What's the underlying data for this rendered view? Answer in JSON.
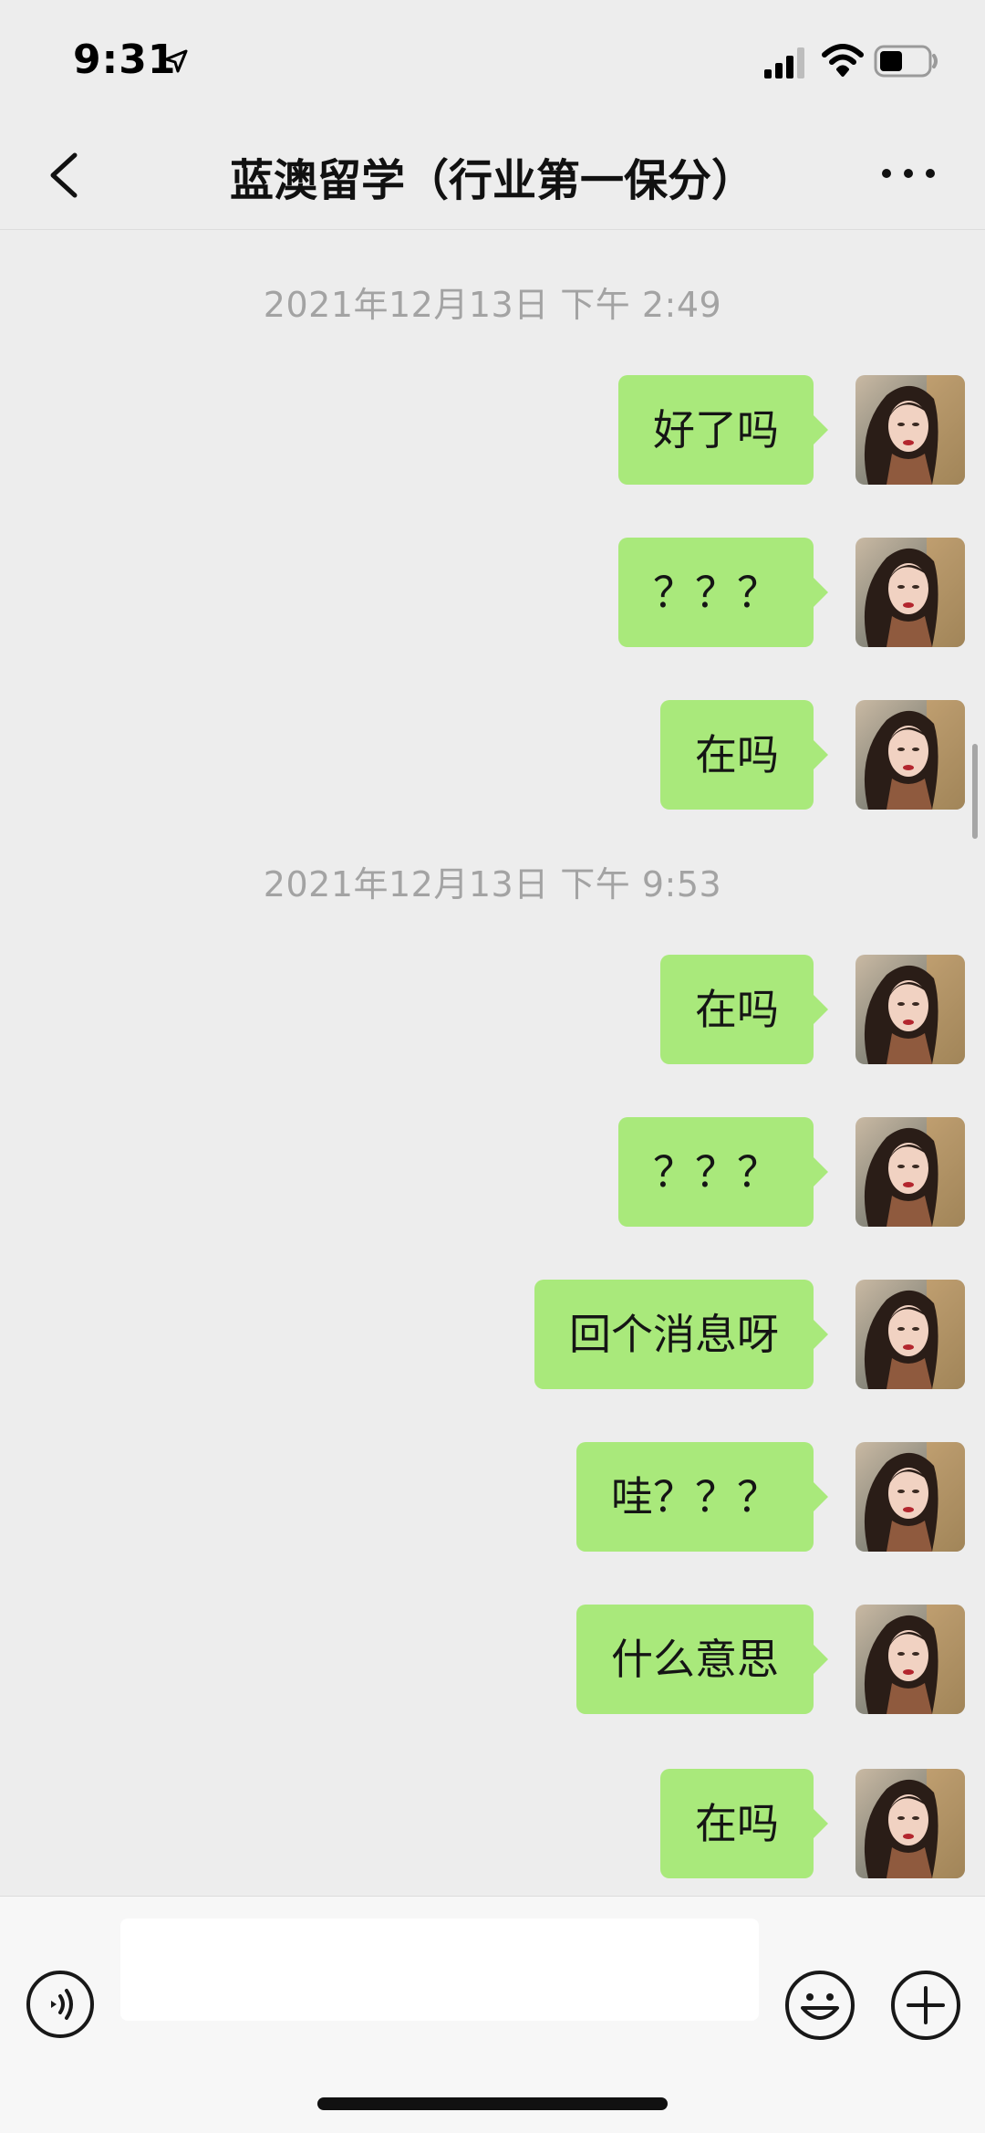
{
  "status_bar": {
    "time": "9:31"
  },
  "nav": {
    "title": "蓝澳留学（行业第一保分）"
  },
  "timestamps": [
    "2021年12月13日 下午 2:49",
    "2021年12月13日 下午 9:53"
  ],
  "messages": [
    {
      "text": "好了吗"
    },
    {
      "text": "？？？"
    },
    {
      "text": "在吗"
    },
    {
      "text": "在吗"
    },
    {
      "text": "？？？"
    },
    {
      "text": "回个消息呀"
    },
    {
      "text": "哇？？？"
    },
    {
      "text": "什么意思"
    },
    {
      "text": "在吗"
    }
  ],
  "input": {
    "placeholder": ""
  },
  "colors": {
    "bubble": "#a9e97b",
    "background": "#ededed",
    "timestamp": "#a3a3a3"
  },
  "icons": [
    "location-arrow-icon",
    "signal-icon",
    "wifi-icon",
    "battery-icon",
    "back-icon",
    "more-icon",
    "voice-icon",
    "emoji-icon",
    "add-icon"
  ]
}
